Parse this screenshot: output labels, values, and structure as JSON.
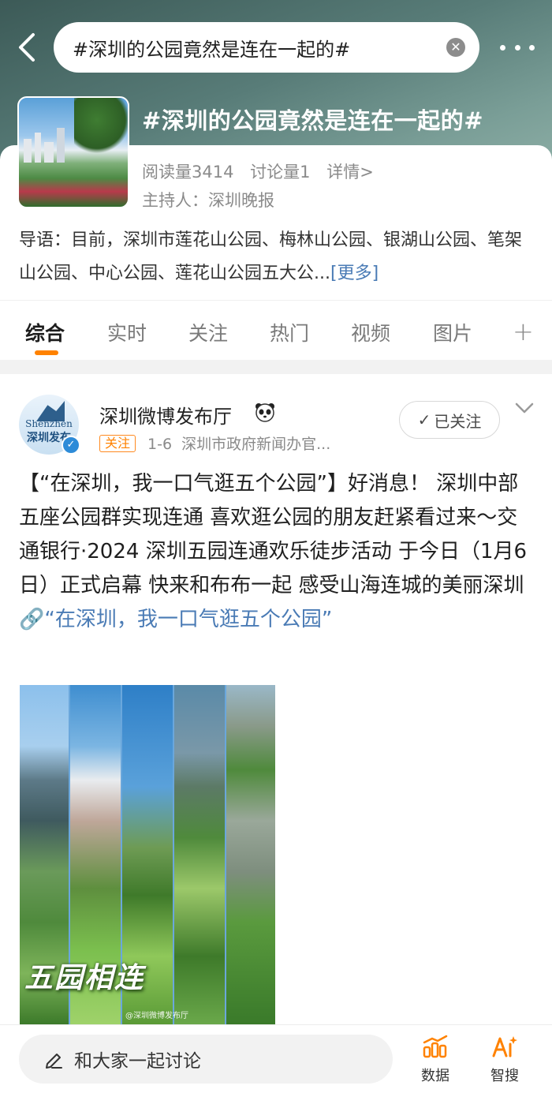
{
  "search": {
    "query": "#深圳的公园竟然是连在一起的#",
    "clear_symbol": "✕"
  },
  "topic": {
    "title": "#深圳的公园竟然是连在一起的#",
    "read_count": "阅读量3414",
    "discuss_count": "讨论量1",
    "details_link": "详情>",
    "host": "主持人：深圳晚报",
    "intro": "导语：目前，深圳市莲花山公园、梅林山公园、银湖山公园、笔架山公园、中心公园、莲花山公园五大公...",
    "intro_more": "[更多]"
  },
  "tabs": [
    {
      "label": "综合",
      "active": true
    },
    {
      "label": "实时",
      "active": false
    },
    {
      "label": "关注",
      "active": false
    },
    {
      "label": "热门",
      "active": false
    },
    {
      "label": "视频",
      "active": false
    },
    {
      "label": "图片",
      "active": false
    }
  ],
  "tab_add": "+",
  "post": {
    "avatar_text_en": "Shenzhen",
    "avatar_text_cn": "深圳发布",
    "author": "深圳微博发布厅",
    "follow_tag": "关注",
    "date": "1-6",
    "source": "深圳市政府新闻办官...",
    "followed_label": "已关注",
    "body": "【“在深圳，我一口气逛五个公园”】好消息！ 深圳中部五座公园群实现连通 喜欢逛公园的朋友赶紧看过来～交通银行·2024 深圳五园连通欢乐徒步活动 于今日（1月6日）正式启幕 快来和布布一起 感受山海连城的美丽深圳 ",
    "link_text": "“在深圳，我一口气逛五个公园”",
    "image_caption": "五园相连",
    "image_watermark": "@深圳微博发布厅"
  },
  "bottom": {
    "comment_placeholder": "和大家一起讨论",
    "data_label": "数据",
    "ai_label": "智搜"
  },
  "colors": {
    "accent": "#ff8200",
    "link": "#4a7bb5",
    "verified": "#2d8bd8"
  }
}
